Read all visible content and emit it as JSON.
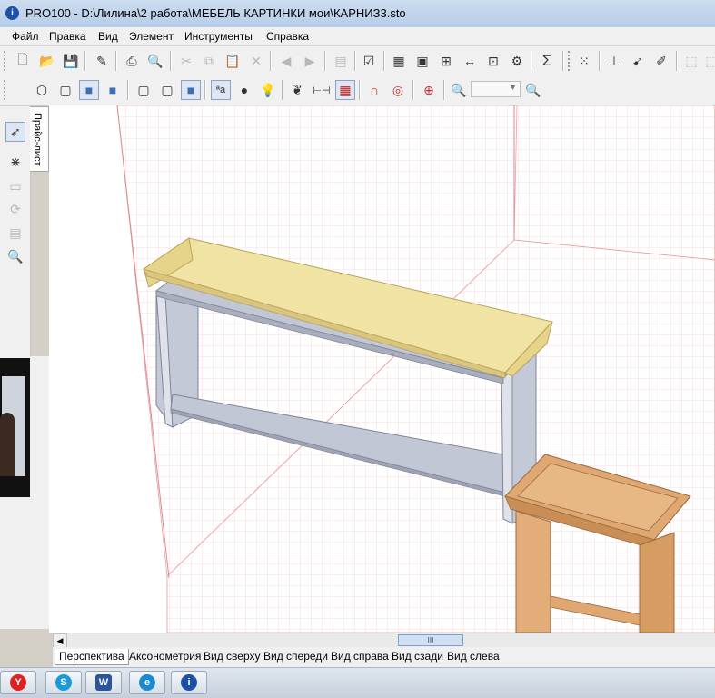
{
  "window": {
    "title": "PRO100 - D:\\Лилина\\2 работа\\МЕБЕЛЬ КАРТИНКИ мои\\КАРНИЗ3.sto",
    "app_icon": "pro100-icon"
  },
  "menu": [
    "Файл",
    "Правка",
    "Вид",
    "Элемент",
    "Инструменты",
    "Справка"
  ],
  "toolbar1": [
    "new-file-icon",
    "open-folder-icon",
    "save-icon",
    "edit-properties-icon",
    "print-icon",
    "print-preview-icon",
    "cut-icon",
    "copy-icon",
    "paste-icon",
    "delete-icon",
    "undo-icon",
    "redo-icon",
    "library-icon",
    "project-info-icon",
    "element-list-icon",
    "catalog-icon",
    "layout-icon",
    "dimension-icon",
    "lamp-icon",
    "settings-icon",
    "sum-icon",
    "grid-dots-icon",
    "align-icon",
    "select-icon",
    "pencil-icon",
    "frame-icon"
  ],
  "toolbar2": [
    "view-cube-1-icon",
    "view-cube-2-icon",
    "view-cube-3-icon",
    "view-cube-4-icon",
    "wire-cube-1-icon",
    "wire-cube-2-icon",
    "solid-cube-icon",
    "text-aa-icon",
    "material-sphere-icon",
    "light-bulb-icon",
    "texture-icon",
    "ruler-icon",
    "grid-icon",
    "magnet-icon",
    "snap-target-icon",
    "center-target-icon",
    "zoom-in-icon",
    "zoom-out-icon"
  ],
  "zoom_value": "",
  "left_tools": [
    "cursor-icon",
    "move-icon",
    "copy-element-icon",
    "rotate-icon",
    "group-icon",
    "zoom-icon"
  ],
  "side_tab": "Прайс-лист",
  "view_tabs": [
    "Перспектива",
    "Аксонометрия",
    "Вид сверху",
    "Вид спереди",
    "Вид справа",
    "Вид сзади",
    "Вид слева"
  ],
  "active_view": "Перспектива",
  "scroll_thumb": "III",
  "taskbar": [
    {
      "icon": "yandex-icon",
      "glyph": "Y",
      "color": "#e02020"
    },
    {
      "icon": "skype-icon",
      "glyph": "S",
      "color": "#1a9bd7"
    },
    {
      "icon": "word-icon",
      "glyph": "W",
      "color": "#2a5699"
    },
    {
      "icon": "ie-icon",
      "glyph": "e",
      "color": "#1a8ad0"
    },
    {
      "icon": "pro100-icon",
      "glyph": "i",
      "color": "#1b4fa8"
    }
  ],
  "colors": {
    "cornice": "#f1e3a4",
    "shelf": "#c2c7d6",
    "furniture_2": "#dfa872",
    "grid": "#f5c8c8"
  }
}
